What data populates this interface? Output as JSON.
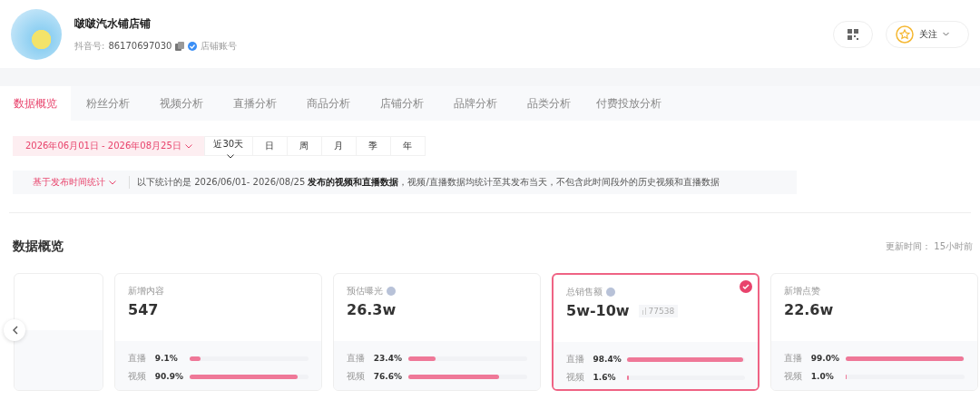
{
  "shop": {
    "name": "啵啵汽水铺店铺",
    "id_label": "抖音号:",
    "id_value": "86170697030",
    "verified_label": "店铺账号"
  },
  "follow_button": {
    "label": "关注"
  },
  "tabs": [
    {
      "label": "数据概览",
      "selected": true
    },
    {
      "label": "粉丝分析",
      "selected": false
    },
    {
      "label": "视频分析",
      "selected": false
    },
    {
      "label": "直播分析",
      "selected": false
    },
    {
      "label": "商品分析",
      "selected": false
    },
    {
      "label": "店铺分析",
      "selected": false
    },
    {
      "label": "品牌分析",
      "selected": false
    },
    {
      "label": "品类分析",
      "selected": false
    },
    {
      "label": "付费投放分析",
      "selected": false
    }
  ],
  "date_range": "2026年06月01日 - 2026年08月25日",
  "periods": [
    {
      "label": "近30天",
      "kind": "dropdown"
    },
    {
      "label": "日",
      "kind": "plain"
    },
    {
      "label": "周",
      "kind": "plain"
    },
    {
      "label": "月",
      "kind": "plain"
    },
    {
      "label": "季",
      "kind": "plain"
    },
    {
      "label": "年",
      "kind": "plain"
    }
  ],
  "stat_mode": "基于发布时间统计",
  "notice": "以下统计的是 2026/06/01- 2026/08/25 **发布的视频和直播数据**，视频/直播数据均统计至其发布当天，不包含此时间段外的历史视频和直播数据",
  "section_title": "数据概览",
  "update_time": "更新时间： 15小时前",
  "cards": [
    {
      "label": "新增内容",
      "help": false,
      "value": "547",
      "selected": false,
      "rows": [
        {
          "label": "直播",
          "percent": "9.1%",
          "level": 0.091
        },
        {
          "label": "视频",
          "percent": "90.9%",
          "level": 0.909
        }
      ]
    },
    {
      "label": "预估曝光",
      "help": true,
      "value": "26.3w",
      "selected": false,
      "rows": [
        {
          "label": "直播",
          "percent": "23.4%",
          "level": 0.234
        },
        {
          "label": "视频",
          "percent": "76.6%",
          "level": 0.766
        }
      ]
    },
    {
      "label": "总销售额",
      "help": true,
      "value": "5w-10w",
      "tag": "77538",
      "selected": true,
      "rows": [
        {
          "label": "直播",
          "percent": "98.4%",
          "level": 0.984
        },
        {
          "label": "视频",
          "percent": "1.6%",
          "level": 0.016
        }
      ]
    },
    {
      "label": "新增点赞",
      "help": false,
      "value": "22.6w",
      "selected": false,
      "rows": [
        {
          "label": "直播",
          "percent": "99.0%",
          "level": 0.99
        },
        {
          "label": "视频",
          "percent": "1.0%",
          "level": 0.01
        }
      ]
    }
  ]
}
